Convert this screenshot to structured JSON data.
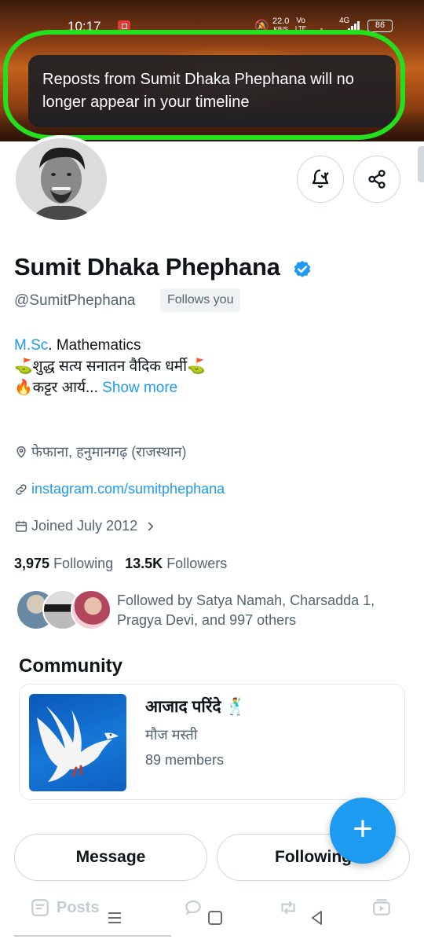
{
  "status_bar": {
    "time": "10:17",
    "speed_value": "22.0",
    "speed_unit": "KB/S",
    "volte_top": "Vo",
    "volte_bottom": "LTE",
    "network": "4G",
    "battery": "86"
  },
  "toast": {
    "message": "Reposts from Sumit Dhaka Phephana will no longer appear in your timeline"
  },
  "profile": {
    "name": "Sumit Dhaka Phephana",
    "handle": "@SumitPhephana",
    "follows_you": "Follows you",
    "bio": {
      "line1_link": "M.Sc",
      "line1_text": ". Mathematics",
      "line2": "⛳शुद्ध सत्य सनातन वैदिक धर्मी⛳",
      "line3": "🔥कट्टर आर्य...",
      "show_more": "Show more"
    },
    "location": "फेफाना, हनुमानगढ़ (राजस्थान)",
    "website": "instagram.com/sumitphephana",
    "joined": "Joined July 2012",
    "following_count": "3,975",
    "following_label": "Following",
    "followers_count": "13.5K",
    "followers_label": "Followers",
    "followed_by": "Followed by Satya Namah, Charsadda 1, Pragya Devi, and 997 others"
  },
  "community": {
    "heading": "Community",
    "name": "आजाद परिंदे 🕺",
    "description": "मौज मस्ती",
    "members": "89 members"
  },
  "actions": {
    "message": "Message",
    "following": "Following",
    "compose": "+"
  },
  "tabs": {
    "posts": "Posts"
  },
  "colors": {
    "accent": "#1d9bf0",
    "highlight": "#22e01c",
    "toast_bg": "#1d2024"
  }
}
